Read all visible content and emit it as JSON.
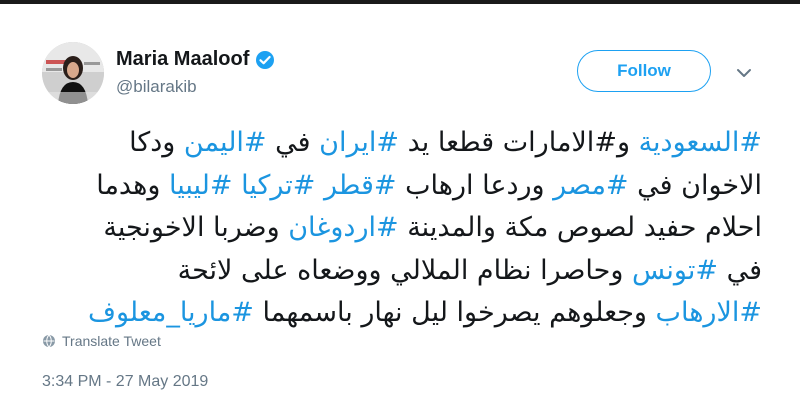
{
  "user": {
    "display_name": "Maria Maaloof",
    "handle": "@bilarakib",
    "verified": true
  },
  "actions": {
    "follow_label": "Follow",
    "more_icon": "chevron-down-icon"
  },
  "tweet": {
    "lines": [
      [
        {
          "t": "#السعودية",
          "h": true
        },
        {
          "t": " و",
          "h": false
        },
        {
          "t": "#الامارات",
          "h": false
        },
        {
          "t": " قطعا يد ",
          "h": false
        },
        {
          "t": "#ايران",
          "h": true
        },
        {
          "t": " في ",
          "h": false
        },
        {
          "t": "#اليمن",
          "h": true
        },
        {
          "t": " ودكا",
          "h": false
        }
      ],
      [
        {
          "t": "الاخوان في ",
          "h": false
        },
        {
          "t": "#مصر",
          "h": true
        },
        {
          "t": " وردعا ارهاب ",
          "h": false
        },
        {
          "t": "#قطر",
          "h": true
        },
        {
          "t": " ",
          "h": false
        },
        {
          "t": "#تركيا",
          "h": true
        },
        {
          "t": " ",
          "h": false
        },
        {
          "t": "#ليبيا",
          "h": true
        },
        {
          "t": " وهدما",
          "h": false
        }
      ],
      [
        {
          "t": "احلام حفيد لصوص مكة والمدينة ",
          "h": false
        },
        {
          "t": "#اردوغان",
          "h": true
        },
        {
          "t": " وضربا الاخونجية",
          "h": false
        }
      ],
      [
        {
          "t": "في ",
          "h": false
        },
        {
          "t": "#تونس",
          "h": true
        },
        {
          "t": " وحاصرا نظام الملالي ووضعاه على لائحة",
          "h": false
        }
      ],
      [
        {
          "t": "#الارهاب",
          "h": true
        },
        {
          "t": " وجعلوهم يصرخوا ليل نهار باسمهما ",
          "h": false
        },
        {
          "t": "#ماريا_معلوف",
          "h": true
        }
      ]
    ],
    "translate_label": "Translate Tweet",
    "timestamp": "3:34 PM - 27 May 2019"
  },
  "colors": {
    "link": "#1b95e0",
    "follow_accent": "#1da1f2",
    "secondary_text": "#657786",
    "primary_text": "#14171a"
  }
}
